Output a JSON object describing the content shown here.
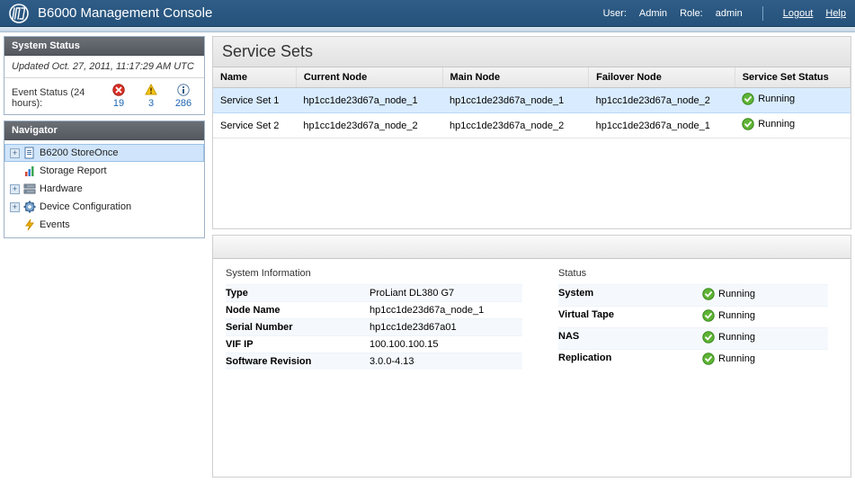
{
  "header": {
    "title": "B6000 Management Console",
    "user_label": "User:",
    "user_value": "Admin",
    "role_label": "Role:",
    "role_value": "admin",
    "logout": "Logout",
    "help": "Help"
  },
  "system_status": {
    "panel_title": "System Status",
    "updated": "Updated Oct. 27, 2011, 11:17:29 AM UTC",
    "event_status_label": "Event Status (24 hours):",
    "error_count": "19",
    "warn_count": "3",
    "info_count": "286"
  },
  "navigator": {
    "panel_title": "Navigator",
    "items": [
      {
        "label": "B6200 StoreOnce",
        "icon": "doc-icon",
        "expandable": true,
        "selected": true
      },
      {
        "label": "Storage Report",
        "icon": "chart-icon",
        "expandable": false,
        "selected": false
      },
      {
        "label": "Hardware",
        "icon": "server-icon",
        "expandable": true,
        "selected": false
      },
      {
        "label": "Device Configuration",
        "icon": "gear-icon",
        "expandable": true,
        "selected": false
      },
      {
        "label": "Events",
        "icon": "bolt-icon",
        "expandable": false,
        "selected": false
      }
    ]
  },
  "main": {
    "title": "Service Sets",
    "columns": [
      "Name",
      "Current Node",
      "Main Node",
      "Failover Node",
      "Service Set Status"
    ],
    "rows": [
      {
        "name": "Service Set 1",
        "current": "hp1cc1de23d67a_node_1",
        "main": "hp1cc1de23d67a_node_1",
        "failover": "hp1cc1de23d67a_node_2",
        "status": "Running",
        "selected": true
      },
      {
        "name": "Service Set 2",
        "current": "hp1cc1de23d67a_node_2",
        "main": "hp1cc1de23d67a_node_2",
        "failover": "hp1cc1de23d67a_node_1",
        "status": "Running",
        "selected": false
      }
    ]
  },
  "detail": {
    "sysinfo_title": "System Information",
    "sysinfo": [
      {
        "k": "Type",
        "v": "ProLiant DL380 G7"
      },
      {
        "k": "Node Name",
        "v": "hp1cc1de23d67a_node_1"
      },
      {
        "k": "Serial Number",
        "v": "hp1cc1de23d67a01"
      },
      {
        "k": "VIF IP",
        "v": "100.100.100.15"
      },
      {
        "k": "Software Revision",
        "v": "3.0.0-4.13"
      }
    ],
    "status_title": "Status",
    "status": [
      {
        "k": "System",
        "v": "Running"
      },
      {
        "k": "Virtual Tape",
        "v": "Running"
      },
      {
        "k": "NAS",
        "v": "Running"
      },
      {
        "k": "Replication",
        "v": "Running"
      }
    ]
  }
}
